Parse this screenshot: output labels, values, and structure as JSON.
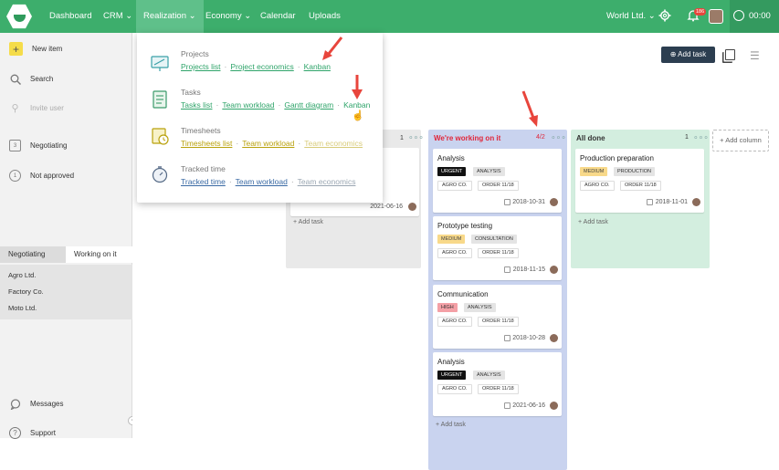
{
  "topnav": {
    "items": [
      "Dashboard",
      "CRM",
      "Realization",
      "Economy",
      "Calendar",
      "Uploads"
    ],
    "company": "World Ltd.",
    "notif_count": "186",
    "timer": "00:00"
  },
  "sidebar": {
    "new_item": "New item",
    "search": "Search",
    "invite_user": "Invite user",
    "negotiating": "Negotiating",
    "negotiating_count": "3",
    "not_approved": "Not approved",
    "not_approved_count": "1",
    "tabs": [
      "Negotiating",
      "Working on it"
    ],
    "orgs": [
      "Agro Ltd.",
      "Factory Co.",
      "Moto Ltd."
    ],
    "messages": "Messages",
    "support": "Support"
  },
  "dropdown": {
    "sections": [
      {
        "title": "Projects",
        "links": [
          "Projects list",
          "Project economics",
          "Kanban"
        ]
      },
      {
        "title": "Tasks",
        "links": [
          "Tasks list",
          "Team workload",
          "Gantt diagram",
          "Kanban"
        ]
      },
      {
        "title": "Timesheets",
        "links": [
          "Timesheets list",
          "Team workload",
          "Team economics"
        ]
      },
      {
        "title": "Tracked time",
        "links": [
          "Tracked time",
          "Team workload",
          "Team economics"
        ]
      }
    ]
  },
  "toolbar": {
    "add_task": "Add task"
  },
  "board": {
    "col1": {
      "count": "1",
      "date": "2021-06-16",
      "add": "Add task"
    },
    "col2": {
      "title": "We're working on it",
      "count": "4/2",
      "add": "Add task",
      "cards": [
        {
          "title": "Analysis",
          "tags": [
            "URGENT",
            "ANALYSIS"
          ],
          "refs": [
            "AGRO CO.",
            "ORDER 11/18"
          ],
          "date": "2018-10-31"
        },
        {
          "title": "Prototype testing",
          "tags": [
            "MEDIUM",
            "CONSULTATION"
          ],
          "refs": [
            "AGRO CO.",
            "ORDER 11/18"
          ],
          "date": "2018-11-15"
        },
        {
          "title": "Communication",
          "tags": [
            "HIGH",
            "ANALYSIS"
          ],
          "refs": [
            "AGRO CO.",
            "ORDER 11/18"
          ],
          "date": "2018-10-28"
        },
        {
          "title": "Analysis",
          "tags": [
            "URGENT",
            "ANALYSIS"
          ],
          "refs": [
            "AGRO CO.",
            "ORDER 11/18"
          ],
          "date": "2021-06-16"
        }
      ]
    },
    "col3": {
      "title": "All done",
      "count": "1",
      "add": "Add task",
      "cards": [
        {
          "title": "Production preparation",
          "tags": [
            "MEDIUM",
            "PRODUCTION"
          ],
          "refs": [
            "AGRO CO.",
            "ORDER 11/18"
          ],
          "date": "2018-11-01"
        }
      ]
    },
    "add_column": "Add column"
  },
  "colors": {
    "brand": "#3dae6c",
    "col_working": "#c9d3ef",
    "col_done": "#d3eedf",
    "urgent": "#111111",
    "arrow": "#e8453c"
  }
}
